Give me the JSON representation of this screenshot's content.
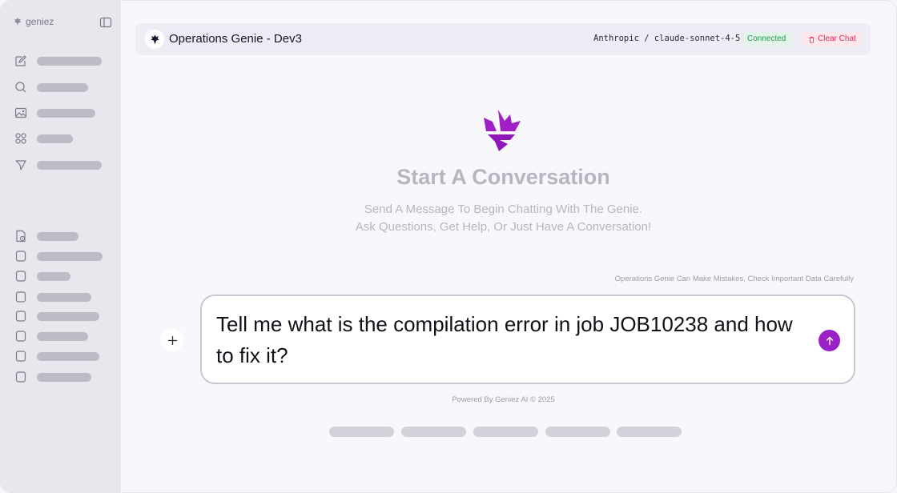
{
  "sidebar": {
    "brand": "geniez",
    "top_icons": [
      "new-chat-icon",
      "search-icon",
      "image-icon",
      "apps-icon",
      "send-icon"
    ],
    "history_icons": [
      "doc-clock-icon",
      "chat-icon",
      "chat-icon",
      "chat-icon",
      "chat-icon",
      "chat-icon",
      "chat-icon",
      "chat-icon"
    ]
  },
  "header": {
    "title": "Operations Genie - Dev3",
    "model": "Anthropic / claude-sonnet-4-5",
    "status": "Connected",
    "clear_label": "Clear Chat"
  },
  "hero": {
    "title": "Start A Conversation",
    "subtitle_line1": "Send A Message To Begin Chatting With The Genie.",
    "subtitle_line2": "Ask Questions, Get Help, Or Just Have A Conversation!"
  },
  "disclaimer": "Operations Genie Can Make Mistakes, Check Important Data Carefully",
  "composer": {
    "value": "Tell me what is the compilation error in job JOB10238 and how to fix it?"
  },
  "footer": "Powered By Geniez AI © 2025",
  "colors": {
    "accent": "#9a20c8",
    "connected": "#1f9a4a",
    "danger": "#e02b55"
  }
}
